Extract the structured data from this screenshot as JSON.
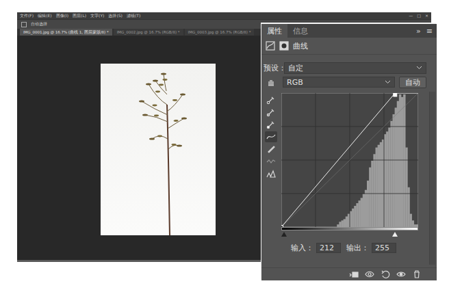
{
  "photoshop": {
    "menu": [
      "文件(F)",
      "编辑(E)",
      "图像(I)",
      "图层(L)",
      "文字(Y)",
      "选择(S)",
      "滤镜(T)"
    ],
    "window_controls": [
      "—",
      "□",
      "×"
    ],
    "options": [
      "自动选择"
    ],
    "documents": [
      {
        "label": "IMG_0001.jpg @ 16.7% (曲线 1, 图层蒙版/8) *",
        "selected": true
      },
      {
        "label": "IMG_0002.jpg @ 16.7% (RGB/8) *",
        "selected": false
      },
      {
        "label": "IMG_0003.jpg @ 16.7% (RGB/8) *",
        "selected": false
      }
    ]
  },
  "panel": {
    "tabs": [
      {
        "label": "属性",
        "selected": true
      },
      {
        "label": "信息",
        "selected": false
      }
    ],
    "collapse": "»",
    "menu": "≡",
    "title": "曲线",
    "preset": {
      "label": "预设：",
      "value": "自定"
    },
    "channel": {
      "value": "RGB"
    },
    "auto_button": "自动",
    "tools": [
      {
        "kind": "eyedropper-black",
        "selected": false
      },
      {
        "kind": "eyedropper-gray",
        "selected": false
      },
      {
        "kind": "eyedropper-white",
        "selected": false
      },
      {
        "kind": "curve",
        "selected": true
      },
      {
        "kind": "pencil",
        "selected": false
      },
      {
        "kind": "smooth",
        "selected": false
      },
      {
        "kind": "clip-warning",
        "selected": false
      }
    ],
    "curve": {
      "points": [
        [
          0,
          0
        ],
        [
          212,
          255
        ]
      ],
      "selected_point": 1
    },
    "histogram": [
      0,
      0,
      0,
      0,
      0,
      0,
      0,
      0,
      0,
      0,
      0,
      0,
      0,
      0,
      0,
      0,
      0,
      0,
      0,
      0,
      0,
      0,
      0,
      0,
      0,
      0,
      0.02,
      0.04,
      0.05,
      0.06,
      0.08,
      0.1,
      0.12,
      0.14,
      0.16,
      0.18,
      0.2,
      0.22,
      0.25,
      0.28,
      0.35,
      0.45,
      0.5,
      0.55,
      0.6,
      0.62,
      0.64,
      0.66,
      0.7,
      0.72,
      0.75,
      0.8,
      0.85,
      0.9,
      0.95,
      1.0,
      0.98,
      1.0,
      0.6,
      0.3,
      0.1,
      0.05,
      0.02,
      0.02
    ],
    "sliders": {
      "black": 0,
      "white": 212
    },
    "input": {
      "label": "输入：",
      "value": "212"
    },
    "output": {
      "label": "输出：",
      "value": "255"
    }
  }
}
